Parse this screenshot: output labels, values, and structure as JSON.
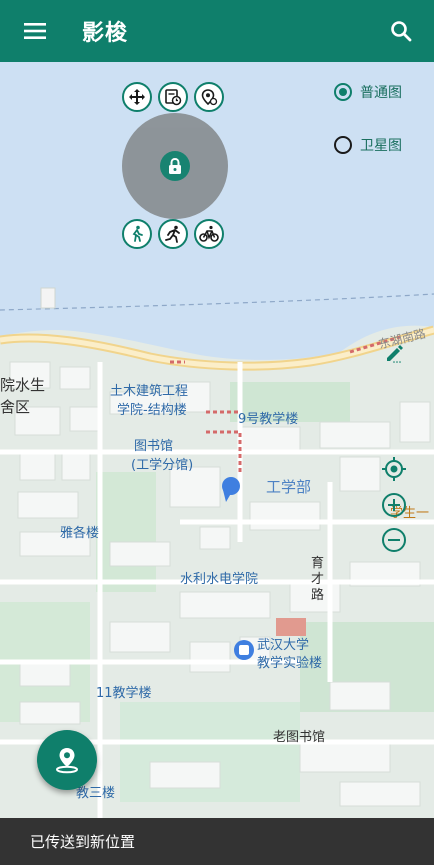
{
  "app": {
    "title": "影梭"
  },
  "icons": {
    "menu": "menu-icon",
    "search": "search-icon",
    "lock": "lock-icon",
    "pin": "location-pin-icon"
  },
  "colors": {
    "primary": "#0f7f6b",
    "water": "#cde0f3",
    "road": "#f6dfa6"
  },
  "map_type": {
    "selected": "普通图",
    "options": [
      "普通图",
      "卫星图"
    ]
  },
  "joystick": {
    "top_buttons": [
      "move-icon",
      "history-icon",
      "location-settings-icon"
    ],
    "bottom_buttons": [
      "walk-icon",
      "run-icon",
      "bike-icon"
    ],
    "locked": true
  },
  "map_labels": {
    "east_lake_south": "东湖南路",
    "water_dorm_1": "院水生",
    "water_dorm_2": "舍区",
    "civil_1": "土木建筑工程",
    "civil_2": "学院-结构楼",
    "bldg9": "9号教学楼",
    "library_1": "图书馆",
    "library_2": "(工学分馆)",
    "engineering_dept": "工学部",
    "student": "学生一",
    "yage": "雅各楼",
    "hydro": "水利水电学院",
    "yucai_1": "育",
    "yucai_2": "才",
    "yucai_3": "路",
    "whu_1": "武汉大学",
    "whu_2": "教学实验楼",
    "bldg11": "11教学楼",
    "old_library": "老图书馆",
    "teach3": "教三楼"
  },
  "snackbar": {
    "message": "已传送到新位置"
  }
}
